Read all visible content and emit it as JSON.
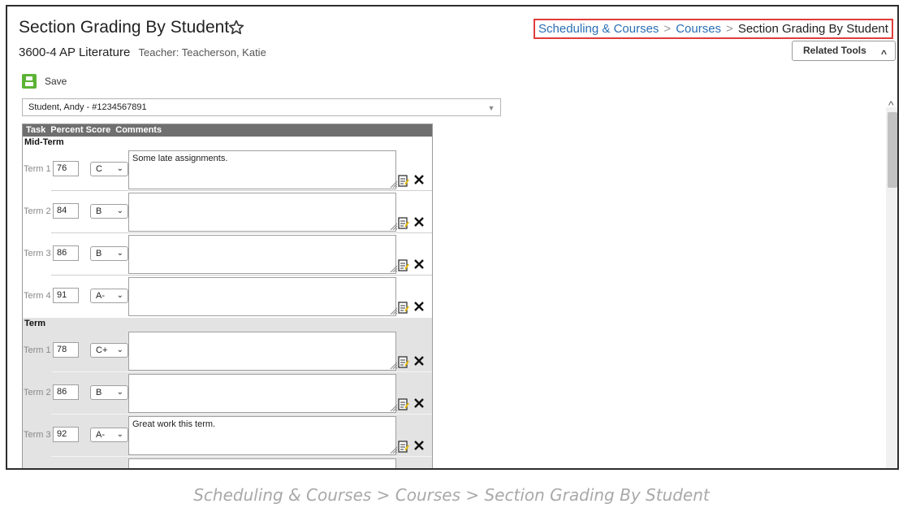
{
  "page": {
    "title": "Section Grading By Student",
    "section": "3600-4 AP Literature",
    "teacher": "Teacher: Teacherson, Katie"
  },
  "breadcrumb": {
    "item1": "Scheduling & Courses",
    "item2": "Courses",
    "item3": "Section Grading By Student",
    "separator": ">"
  },
  "related_tools": {
    "label": "Related Tools",
    "icon": "chevron-up-icon"
  },
  "toolbar": {
    "save_label": "Save"
  },
  "student_select": {
    "selected": "Student, Andy - #1234567891"
  },
  "grid": {
    "headers": [
      "Task",
      "Percent Score",
      "Comments"
    ],
    "groups": [
      {
        "name": "Mid-Term",
        "rows": [
          {
            "term": "Term 1",
            "percent": "76",
            "grade": "C",
            "comment": "Some late assignments."
          },
          {
            "term": "Term 2",
            "percent": "84",
            "grade": "B",
            "comment": ""
          },
          {
            "term": "Term 3",
            "percent": "86",
            "grade": "B",
            "comment": ""
          },
          {
            "term": "Term 4",
            "percent": "91",
            "grade": "A-",
            "comment": ""
          }
        ]
      },
      {
        "name": "Term",
        "rows": [
          {
            "term": "Term 1",
            "percent": "78",
            "grade": "C+",
            "comment": ""
          },
          {
            "term": "Term 2",
            "percent": "86",
            "grade": "B",
            "comment": ""
          },
          {
            "term": "Term 3",
            "percent": "92",
            "grade": "A-",
            "comment": "Great work this term."
          }
        ]
      }
    ]
  },
  "caption": "Scheduling & Courses > Courses > Section Grading By Student",
  "colors": {
    "link": "#2a6fb5",
    "highlight_border": "#e03c3c",
    "save_green": "#5cb335",
    "grid_header": "#6f6f6f"
  }
}
